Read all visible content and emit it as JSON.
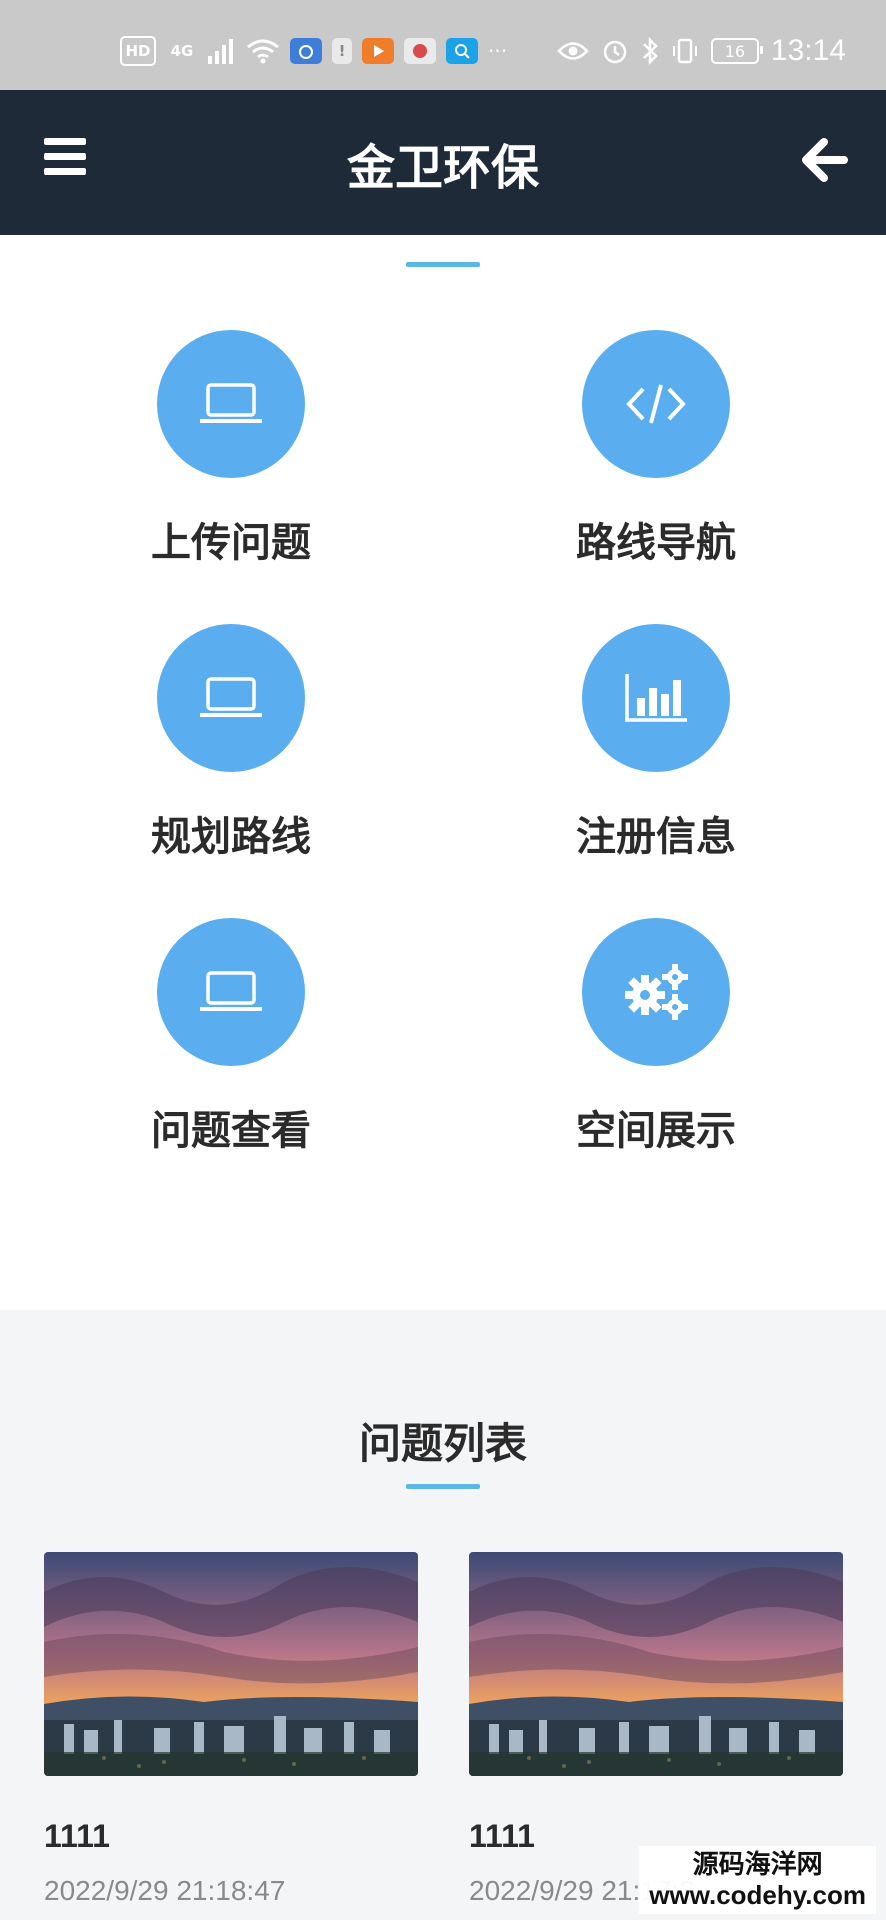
{
  "status_bar": {
    "left_chips": [
      "HD",
      "4G"
    ],
    "battery_level": "16",
    "time": "13:14",
    "overflow": "···"
  },
  "header": {
    "title": "金卫环保"
  },
  "tiles": [
    {
      "label": "上传问题",
      "icon": "laptop-icon"
    },
    {
      "label": "路线导航",
      "icon": "code-icon"
    },
    {
      "label": "规划路线",
      "icon": "laptop-icon"
    },
    {
      "label": "注册信息",
      "icon": "bar-chart-icon"
    },
    {
      "label": "问题查看",
      "icon": "laptop-icon"
    },
    {
      "label": "空间展示",
      "icon": "gears-icon"
    }
  ],
  "problem_list": {
    "title": "问题列表",
    "cards": [
      {
        "title": "1111",
        "date": "2022/9/29 21:18:47"
      },
      {
        "title": "1111",
        "date": "2022/9/29 21:17:3"
      }
    ]
  },
  "watermark": {
    "text": "源码海洋网",
    "url": "www.codehy.com"
  },
  "colors": {
    "header_bg": "#1f2a38",
    "icon_circle": "#5aaeef",
    "accent": "#5bb8e6",
    "section_bg": "#f4f5f7"
  }
}
